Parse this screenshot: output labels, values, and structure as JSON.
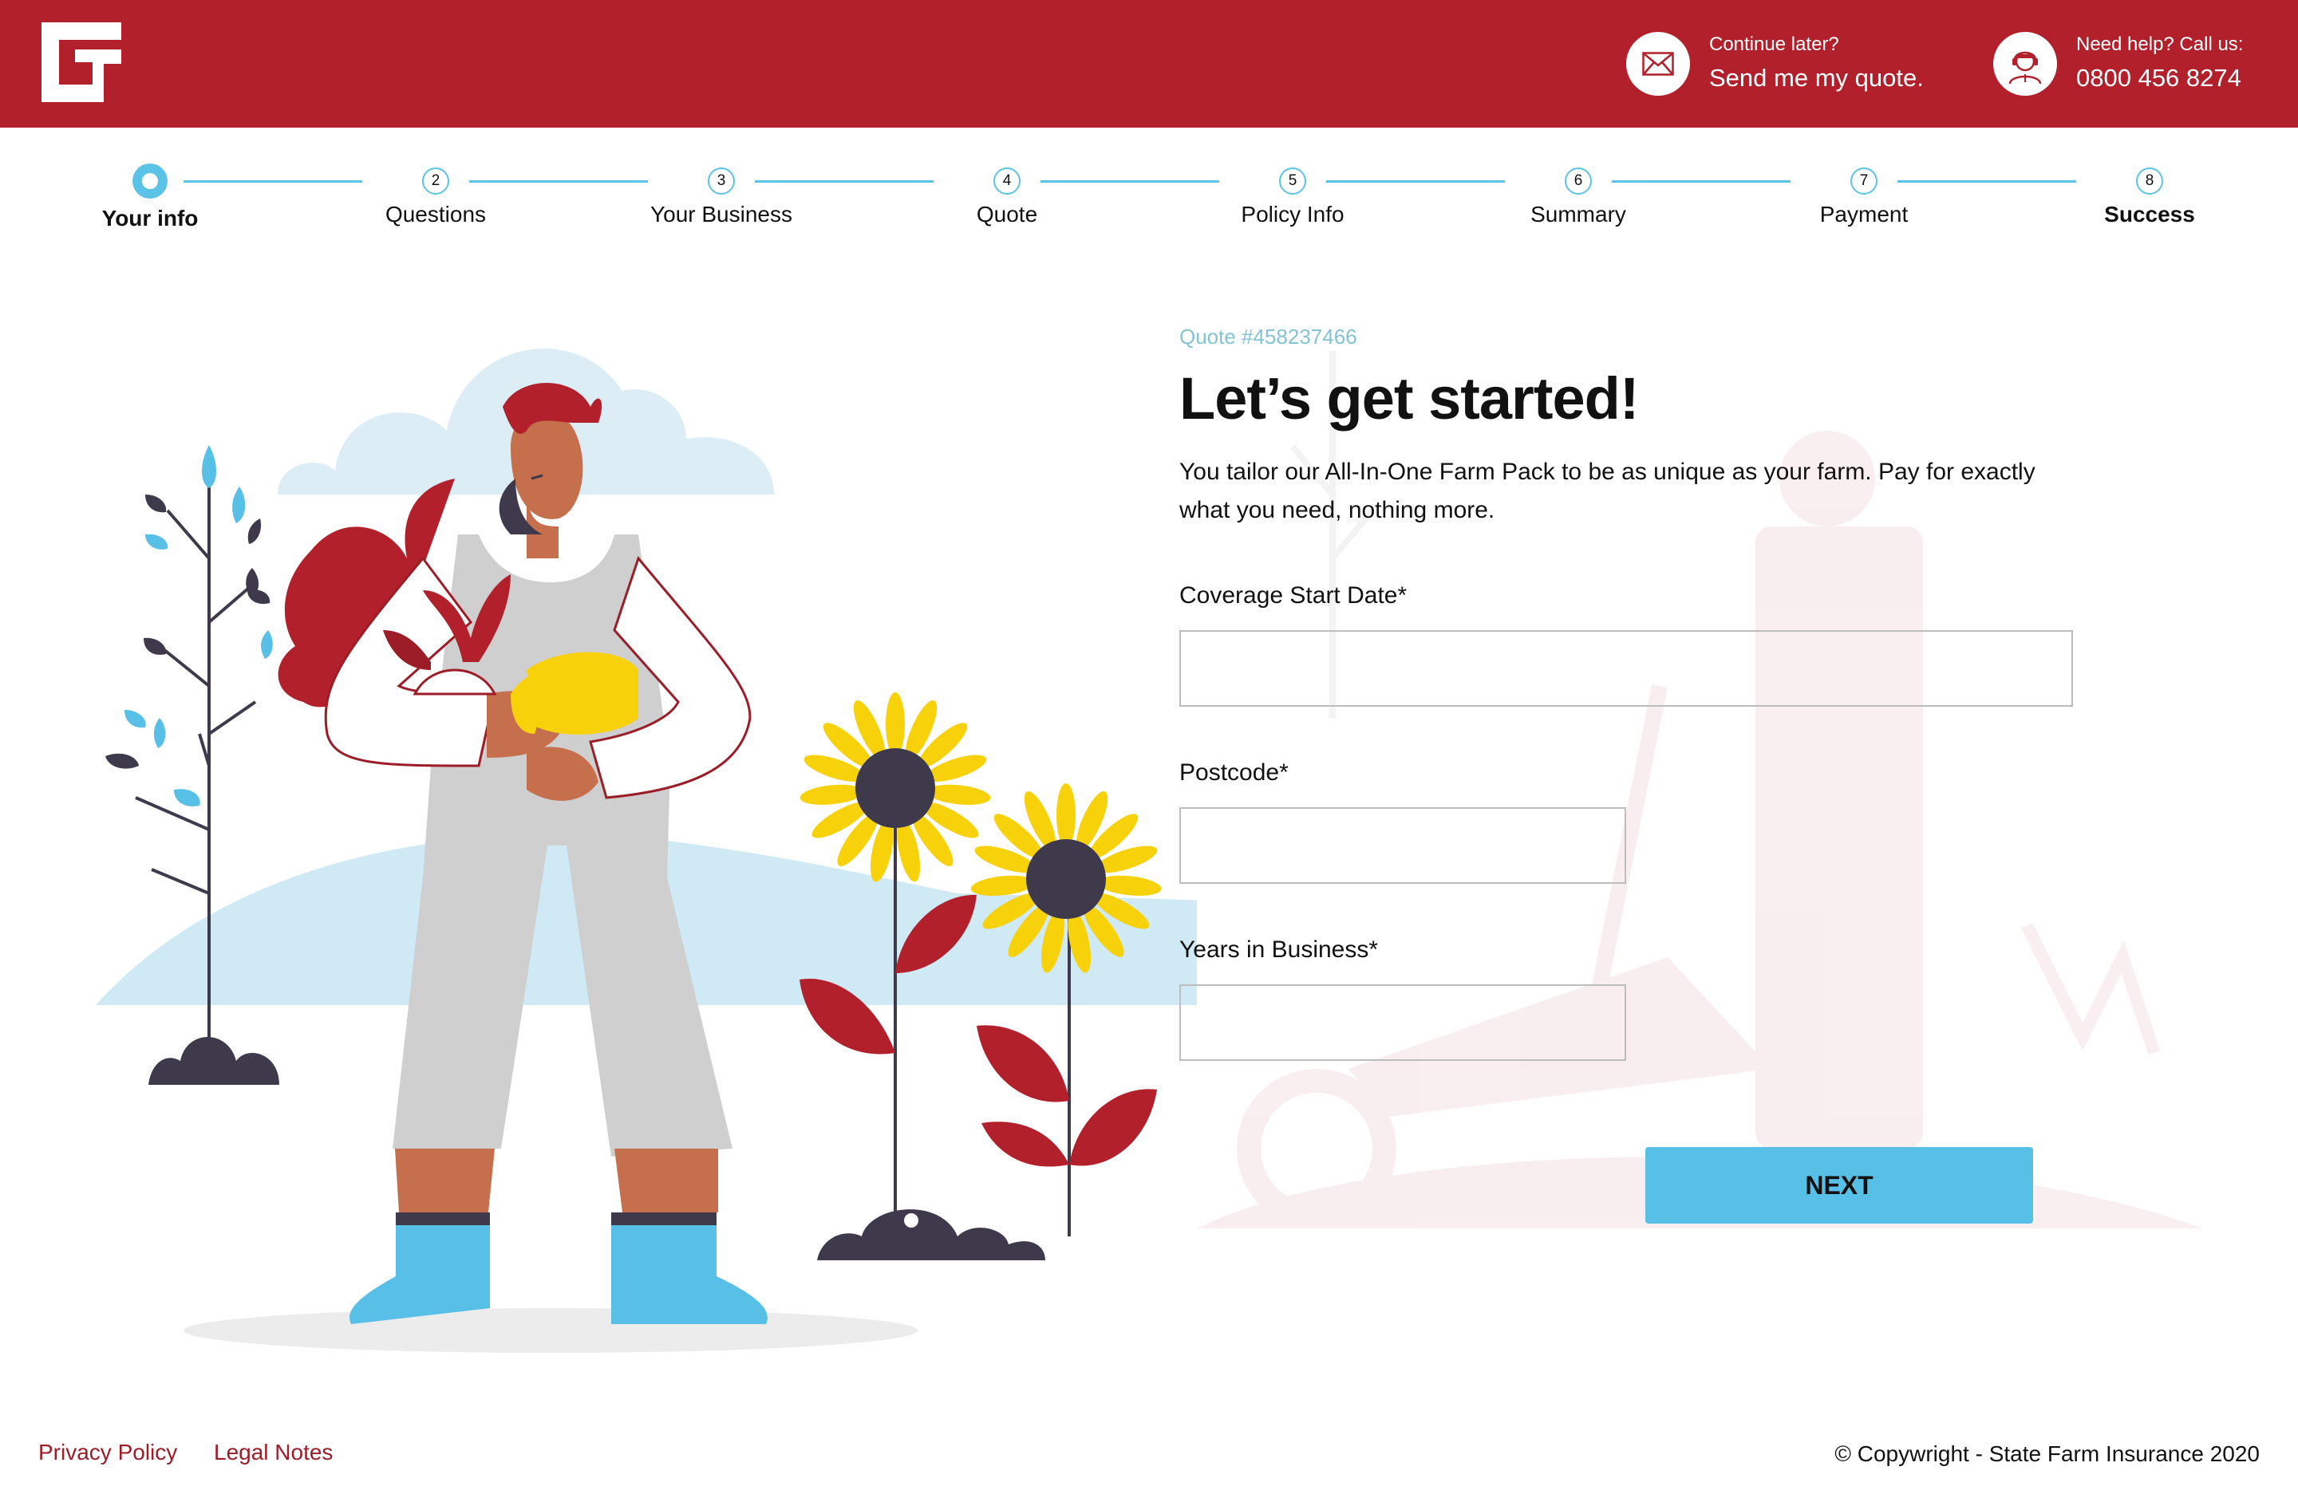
{
  "header": {
    "quote_small": "Continue later?",
    "quote_link": "Send me my quote.",
    "help_small": "Need help? Call us:",
    "help_phone": "0800 456 8274"
  },
  "stepper": {
    "steps": [
      {
        "number": "",
        "label": "Your info",
        "state": "active"
      },
      {
        "number": "2",
        "label": "Questions",
        "state": "pending"
      },
      {
        "number": "3",
        "label": "Your Business",
        "state": "pending"
      },
      {
        "number": "4",
        "label": "Quote",
        "state": "pending"
      },
      {
        "number": "5",
        "label": "Policy Info",
        "state": "pending"
      },
      {
        "number": "6",
        "label": "Summary",
        "state": "pending"
      },
      {
        "number": "7",
        "label": "Payment",
        "state": "pending"
      },
      {
        "number": "8",
        "label": "Success",
        "state": "pending"
      }
    ]
  },
  "form": {
    "quote_number": "Quote #458237466",
    "title": "Let’s get started!",
    "intro": "You tailor our All-In-One Farm Pack to be as unique as your farm. Pay for exactly what you need, nothing more.",
    "fields": {
      "coverage_label": "Coverage Start Date*",
      "coverage_value": "",
      "postcode_label": "Postcode*",
      "postcode_value": "",
      "years_label": "Years in Business*",
      "years_value": ""
    },
    "next_label": "NEXT"
  },
  "footer": {
    "privacy": "Privacy Policy",
    "legal": "Legal Notes",
    "copyright": "© Copywright - State Farm Insurance 2020"
  },
  "colors": {
    "brand_red": "#b2202b",
    "accent_blue": "#58bfe7",
    "quote_blue": "#83c3d6",
    "footer_link": "#9c1d27"
  },
  "icons": {
    "logo": "brand-logo",
    "quote": "envelope-icon",
    "help": "support-agent-icon"
  }
}
